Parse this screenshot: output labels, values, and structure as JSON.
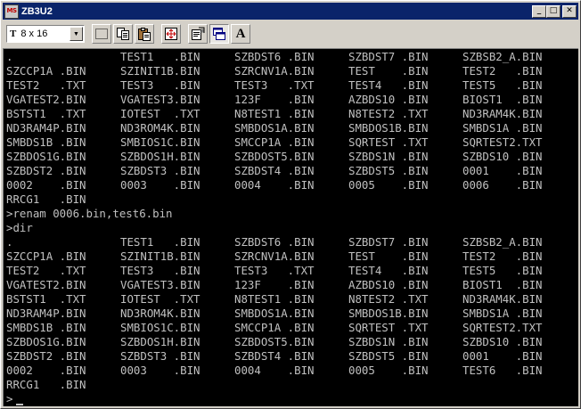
{
  "window": {
    "title": "ZB3U2",
    "app_icon_text": "MS",
    "minimize_glyph": "_",
    "maximize_glyph": "□",
    "close_glyph": "✕"
  },
  "toolbar": {
    "font_icon_text": "T",
    "font_size_value": "8 x 16",
    "dropdown_glyph": "▼",
    "font_button_label": "A",
    "buttons": [
      "mark-icon",
      "copy-icon",
      "paste-icon",
      "fullscreen-icon",
      "properties-icon",
      "background-icon",
      "font-icon"
    ]
  },
  "console": {
    "lines": [
      [
        ".",
        "TEST1   .BIN",
        "SZBDST6 .BIN",
        "SZBDST7 .BIN",
        "SZBSB2_A.BIN"
      ],
      [
        "SZCCP1A .BIN",
        "SZINIT1B.BIN",
        "SZRCNV1A.BIN",
        "TEST    .BIN",
        "TEST2   .BIN"
      ],
      [
        "TEST2   .TXT",
        "TEST3   .BIN",
        "TEST3   .TXT",
        "TEST4   .BIN",
        "TEST5   .BIN"
      ],
      [
        "VGATEST2.BIN",
        "VGATEST3.BIN",
        "123F    .BIN",
        "AZBDS10 .BIN",
        "BIOST1  .BIN"
      ],
      [
        "BSTST1  .TXT",
        "IOTEST  .TXT",
        "N8TEST1 .BIN",
        "N8TEST2 .TXT",
        "ND3RAM4K.BIN"
      ],
      [
        "ND3RAM4P.BIN",
        "ND3ROM4K.BIN",
        "SMBDOS1A.BIN",
        "SMBDOS1B.BIN",
        "SMBDS1A .BIN"
      ],
      [
        "SMBDS1B .BIN",
        "SMBIOS1C.BIN",
        "SMCCP1A .BIN",
        "SQRTEST .TXT",
        "SQRTEST2.TXT"
      ],
      [
        "SZBDOS1G.BIN",
        "SZBDOS1H.BIN",
        "SZBDOST5.BIN",
        "SZBDS1N .BIN",
        "SZBDS10 .BIN"
      ],
      [
        "SZBDST2 .BIN",
        "SZBDST3 .BIN",
        "SZBDST4 .BIN",
        "SZBDST5 .BIN",
        "0001    .BIN"
      ],
      [
        "0002    .BIN",
        "0003    .BIN",
        "0004    .BIN",
        "0005    .BIN",
        "0006    .BIN"
      ],
      [
        "RRCG1   .BIN"
      ],
      [
        ">renam 0006.bin,test6.bin"
      ],
      [
        ">dir"
      ],
      [
        ".",
        "TEST1   .BIN",
        "SZBDST6 .BIN",
        "SZBDST7 .BIN",
        "SZBSB2_A.BIN"
      ],
      [
        "SZCCP1A .BIN",
        "SZINIT1B.BIN",
        "SZRCNV1A.BIN",
        "TEST    .BIN",
        "TEST2   .BIN"
      ],
      [
        "TEST2   .TXT",
        "TEST3   .BIN",
        "TEST3   .TXT",
        "TEST4   .BIN",
        "TEST5   .BIN"
      ],
      [
        "VGATEST2.BIN",
        "VGATEST3.BIN",
        "123F    .BIN",
        "AZBDS10 .BIN",
        "BIOST1  .BIN"
      ],
      [
        "BSTST1  .TXT",
        "IOTEST  .TXT",
        "N8TEST1 .BIN",
        "N8TEST2 .TXT",
        "ND3RAM4K.BIN"
      ],
      [
        "ND3RAM4P.BIN",
        "ND3ROM4K.BIN",
        "SMBDOS1A.BIN",
        "SMBDOS1B.BIN",
        "SMBDS1A .BIN"
      ],
      [
        "SMBDS1B .BIN",
        "SMBIOS1C.BIN",
        "SMCCP1A .BIN",
        "SQRTEST .TXT",
        "SQRTEST2.TXT"
      ],
      [
        "SZBDOS1G.BIN",
        "SZBDOS1H.BIN",
        "SZBDOST5.BIN",
        "SZBDS1N .BIN",
        "SZBDS10 .BIN"
      ],
      [
        "SZBDST2 .BIN",
        "SZBDST3 .BIN",
        "SZBDST4 .BIN",
        "SZBDST5 .BIN",
        "0001    .BIN"
      ],
      [
        "0002    .BIN",
        "0003    .BIN",
        "0004    .BIN",
        "0005    .BIN",
        "TEST6   .BIN"
      ],
      [
        "RRCG1   .BIN"
      ],
      [
        ">"
      ]
    ]
  },
  "colors": {
    "titlebar": "#0a246a",
    "console_bg": "#000000",
    "console_fg": "#c0c0c0",
    "chrome": "#d4d0c8"
  }
}
